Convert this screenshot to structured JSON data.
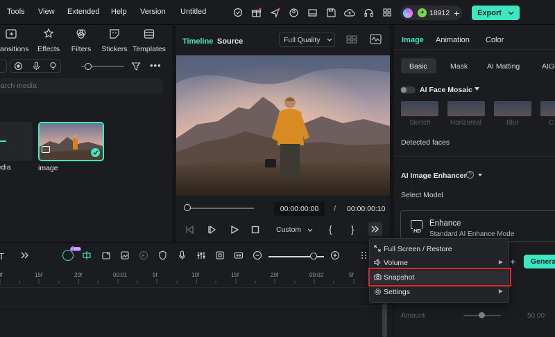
{
  "menubar": {
    "items": [
      "Tools",
      "View",
      "Extended",
      "Help",
      "Version"
    ],
    "project_title": "Untitled",
    "credits": "18912",
    "export_label": "Export"
  },
  "media_panel": {
    "tabs": [
      "Transitions",
      "Effects",
      "Filters",
      "Stickers",
      "Templates"
    ],
    "search_placeholder": "Search media",
    "items": [
      {
        "label": "Media"
      },
      {
        "label": "image"
      }
    ]
  },
  "preview": {
    "tabs": {
      "timeline": "Timeline",
      "source": "Source"
    },
    "quality": "Full Quality",
    "current_time": "00:00:00:00",
    "separator": "/",
    "total_time": "00:00:00:10",
    "speed_mode": "Custom"
  },
  "props": {
    "tabs": [
      "Image",
      "Animation",
      "Color"
    ],
    "subtabs": [
      "Basic",
      "Mask",
      "AI Matting",
      "AIGC"
    ],
    "face_mosaic_label": "AI Face Mosaic",
    "mosaic_styles": [
      "Sketch",
      "Horizontal",
      "Blur",
      "C"
    ],
    "detected_faces": "Detected faces",
    "enhancer_label": "AI Image Enhancer",
    "select_model": "Select Model",
    "enhance_card": {
      "title": "Enhance",
      "subtitle": "Standard AI Enhance Mode",
      "badge": "HD"
    },
    "generate_label": "Genera",
    "amount_label": "Amount",
    "amount_value": "50.00",
    "amount_level": 0.5
  },
  "timeline": {
    "ai_badge": "Free",
    "ruler_ticks": [
      "0f",
      "15f",
      "20f",
      "00:01",
      "5f",
      "10f",
      "15f",
      "20f",
      "00:02",
      "5f"
    ]
  },
  "context_menu": {
    "items": [
      {
        "label": "Full Screen / Restore",
        "has_submenu": false
      },
      {
        "label": "Volume",
        "has_submenu": true
      },
      {
        "label": "Snapshot",
        "has_submenu": false,
        "highlighted": true
      },
      {
        "label": "Settings",
        "has_submenu": true
      }
    ]
  },
  "colors": {
    "accent": "#3ee6c1",
    "highlight_box": "#e0262b",
    "background": "#1b1c1f"
  }
}
